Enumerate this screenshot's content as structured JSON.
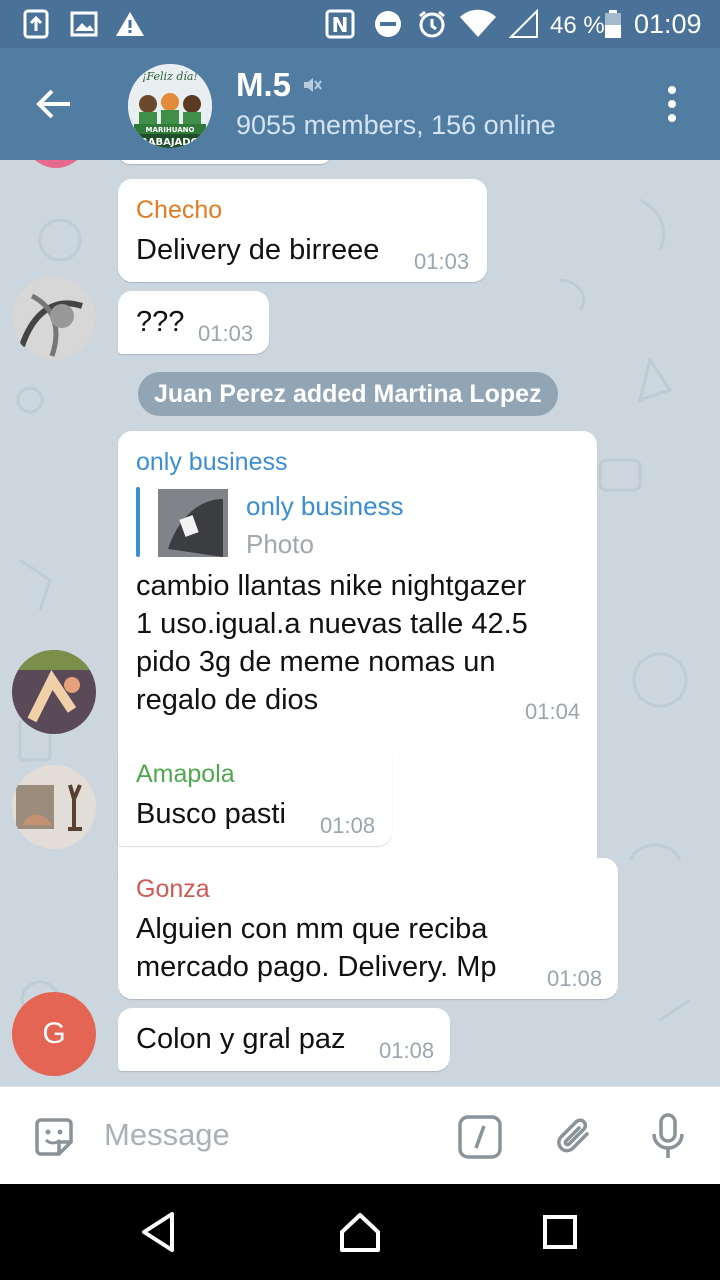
{
  "status_bar": {
    "battery_percent": "46 %",
    "time": "01:09",
    "icons": [
      "upload-icon",
      "image-icon",
      "warning-icon",
      "nfc-icon",
      "do-not-disturb-icon",
      "alarm-icon",
      "wifi-icon",
      "signal-icon",
      "battery-icon"
    ]
  },
  "app_bar": {
    "title": "M.5",
    "subtitle": "9055 members, 156 online",
    "avatar_text": "¡Feliz día! MARIHUANO TRABAJADOR",
    "muted": true
  },
  "messages": [
    {
      "sender": "Checho",
      "sender_color": "#e07b21",
      "text": "Delivery de birreee",
      "time": "01:03"
    },
    {
      "sender": "",
      "text": "???",
      "time": "01:03"
    },
    {
      "service": "Juan Perez added Martina Lopez"
    },
    {
      "sender": "only business",
      "sender_color": "#3a8ed6",
      "reply": {
        "name": "only business",
        "type": "Photo"
      },
      "text_lines": [
        "cambio llantas nike nightgazer",
        "1 uso.igual.a nuevas talle 42.5",
        "pido 3g de meme nomas un",
        "regalo de dios"
      ],
      "time": "01:04"
    },
    {
      "sender": "Amapola",
      "sender_color": "#4fa84f",
      "text": "Busco pasti",
      "time": "01:08"
    },
    {
      "sender": "Gonza",
      "sender_color": "#cf5a55",
      "text_lines": [
        "Alguien con mm que reciba",
        "mercado pago. Delivery. Mp"
      ],
      "time": "01:08",
      "avatar_letter": "G",
      "avatar_color": "#e56555"
    },
    {
      "sender": "",
      "text": "Colon y gral paz",
      "time": "01:08"
    }
  ],
  "input": {
    "placeholder": "Message"
  },
  "colors": {
    "header": "#527da3",
    "status_bar": "#4a7299"
  }
}
